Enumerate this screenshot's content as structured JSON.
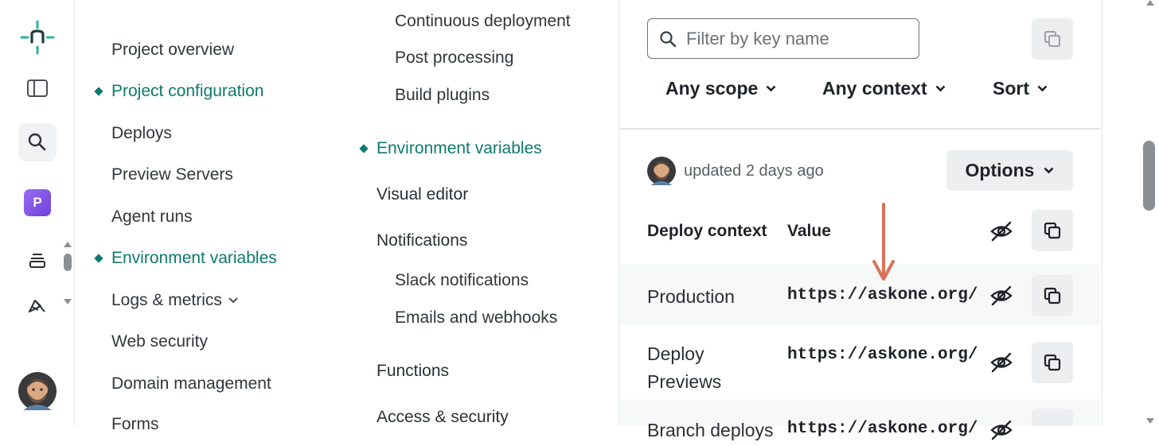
{
  "nav_primary": {
    "items": [
      {
        "label": "Project overview"
      },
      {
        "label": "Project configuration"
      },
      {
        "label": "Deploys"
      },
      {
        "label": "Preview Servers"
      },
      {
        "label": "Agent runs"
      },
      {
        "label": "Environment variables"
      },
      {
        "label": "Logs & metrics"
      },
      {
        "label": "Web security"
      },
      {
        "label": "Domain management"
      },
      {
        "label": "Forms"
      }
    ]
  },
  "nav_secondary": {
    "items": [
      {
        "label": "Continuous deployment"
      },
      {
        "label": "Post processing"
      },
      {
        "label": "Build plugins"
      },
      {
        "label": "Environment variables"
      },
      {
        "label": "Visual editor"
      },
      {
        "label": "Notifications"
      },
      {
        "label": "Slack notifications"
      },
      {
        "label": "Emails and webhooks"
      },
      {
        "label": "Functions"
      },
      {
        "label": "Access & security"
      }
    ]
  },
  "rail": {
    "workspace_letter": "P",
    "icons": [
      "netlify-logo-icon",
      "sidebar-toggle-icon",
      "search-icon",
      "workspace-avatar",
      "layers-icon",
      "rocket-icon",
      "user-avatar"
    ]
  },
  "filters": {
    "search_placeholder": "Filter by key name",
    "scope_label": "Any scope",
    "context_label": "Any context",
    "sort_label": "Sort"
  },
  "variable": {
    "updated_text": "updated 2 days ago",
    "options_label": "Options",
    "columns": {
      "context": "Deploy context",
      "value": "Value"
    },
    "rows": [
      {
        "context": "Production",
        "value": "https://askone.org/"
      },
      {
        "context": "Deploy Previews",
        "value": "https://askone.org/"
      },
      {
        "context": "Branch deploys",
        "value": "https://askone.org/"
      }
    ]
  },
  "colors": {
    "accent": "#0d7a6f",
    "annotation_arrow": "#d9735a",
    "workspace": "#8b5cf6"
  }
}
